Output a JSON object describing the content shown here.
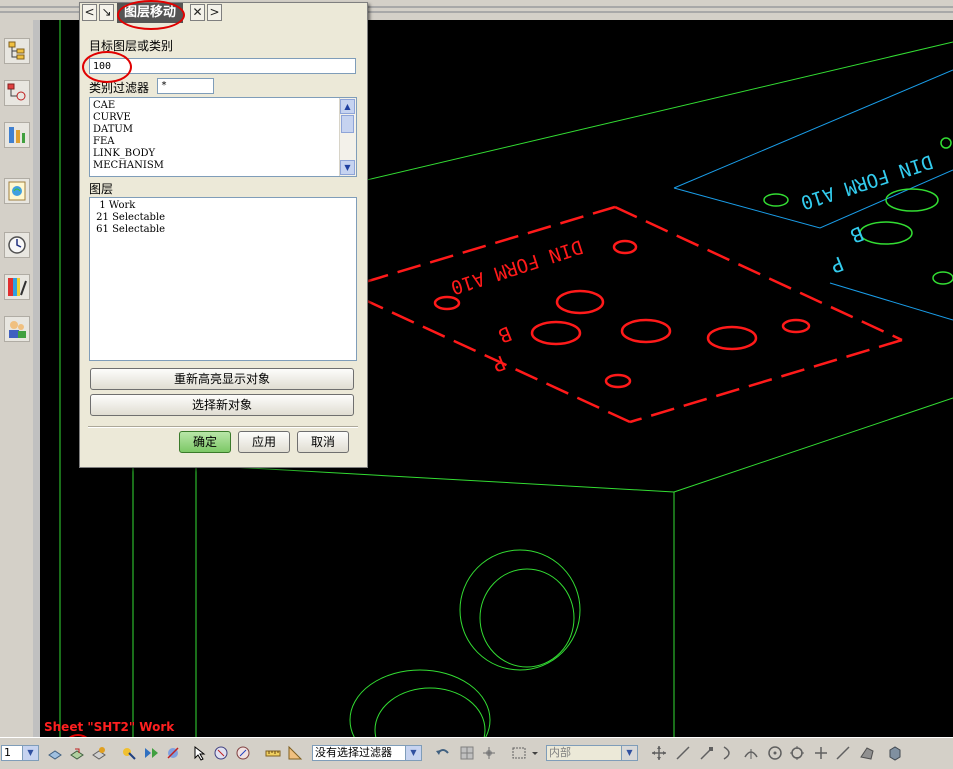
{
  "dialog": {
    "title": "图层移动",
    "target_label": "目标图层或类别",
    "target_value": "100",
    "filter_label": "类别过滤器",
    "filter_value": "*",
    "categories": [
      "CAE",
      "CURVE",
      "DATUM",
      "FEA",
      "LINK_BODY",
      "MECHANISM"
    ],
    "layers_label": "图层",
    "layers": [
      "  1 Work",
      " 21 Selectable",
      " 61 Selectable"
    ],
    "rehighlight_button": "重新高亮显示对象",
    "reselect_button": "选择新对象",
    "ok_button": "确定",
    "apply_button": "应用",
    "cancel_button": "取消"
  },
  "graphics": {
    "sheet_label": "Sheet \"SHT2\" Work",
    "engraving_text_red": "DIN FORM A10",
    "engraving_text_cyan": "DIN FORM A10",
    "colors": {
      "background": "#000000",
      "edges": "#33dd33",
      "red_text": "#ff1a1a",
      "cyan_text": "#33ccee"
    }
  },
  "bottom_toolbar": {
    "layer_value": "1",
    "selection_filter": "没有选择过滤器",
    "scope": "内部"
  },
  "left_toolbar": {
    "icons": [
      "assembly-navigator-icon",
      "part-navigator-icon",
      "reuse-library-icon",
      "web-browser-icon",
      "history-icon",
      "system-materials-icon",
      "roles-icon"
    ]
  }
}
